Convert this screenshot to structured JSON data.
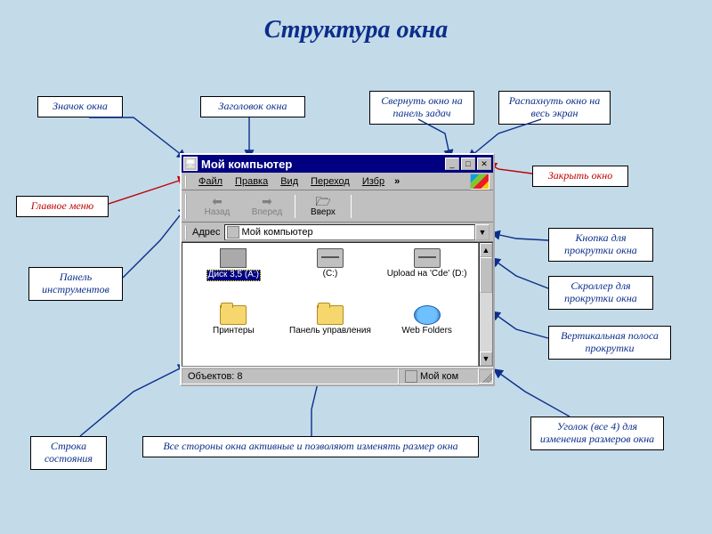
{
  "page": {
    "title": "Структура окна"
  },
  "callouts": {
    "window_icon": "Значок окна",
    "title_text": "Заголовок окна",
    "minimize": "Свернуть окно на панель задач",
    "maximize": "Распахнуть окно на весь экран",
    "close": "Закрыть окно",
    "main_menu": "Главное меню",
    "toolbar": "Панель инструментов",
    "scroll_button": "Кнопка для прокрутки окна",
    "scroll_thumb": "Скроллер для прокрутки окна",
    "scrollbar": "Вертикальная полоса прокрутки",
    "resize_corner": "Уголок  (все 4) для изменения размеров окна",
    "status_bar": "Строка состояния",
    "sides_note": "Все стороны окна активные и позволяют изменять размер окна"
  },
  "window": {
    "title": "Мой компьютер",
    "menu": {
      "file": "Файл",
      "edit": "Правка",
      "view": "Вид",
      "go": "Переход",
      "fav": "Избр",
      "more": "»"
    },
    "toolbar": {
      "back": "Назад",
      "forward": "Вперед",
      "up": "Вверх"
    },
    "address": {
      "label": "Адрес",
      "value": "Мой компьютер"
    },
    "items": [
      {
        "label": "Диск 3,5 (A:)",
        "icon": "floppy",
        "selected": true
      },
      {
        "label": "(C:)",
        "icon": "drive",
        "selected": false
      },
      {
        "label": "Upload на 'Cde' (D:)",
        "icon": "drive",
        "selected": false
      },
      {
        "label": "Принтеры",
        "icon": "folder",
        "selected": false
      },
      {
        "label": "Панель управления",
        "icon": "folder",
        "selected": false
      },
      {
        "label": "Web Folders",
        "icon": "globe",
        "selected": false
      }
    ],
    "status": {
      "objects": "Объектов: 8",
      "location": "Мой ком"
    }
  }
}
